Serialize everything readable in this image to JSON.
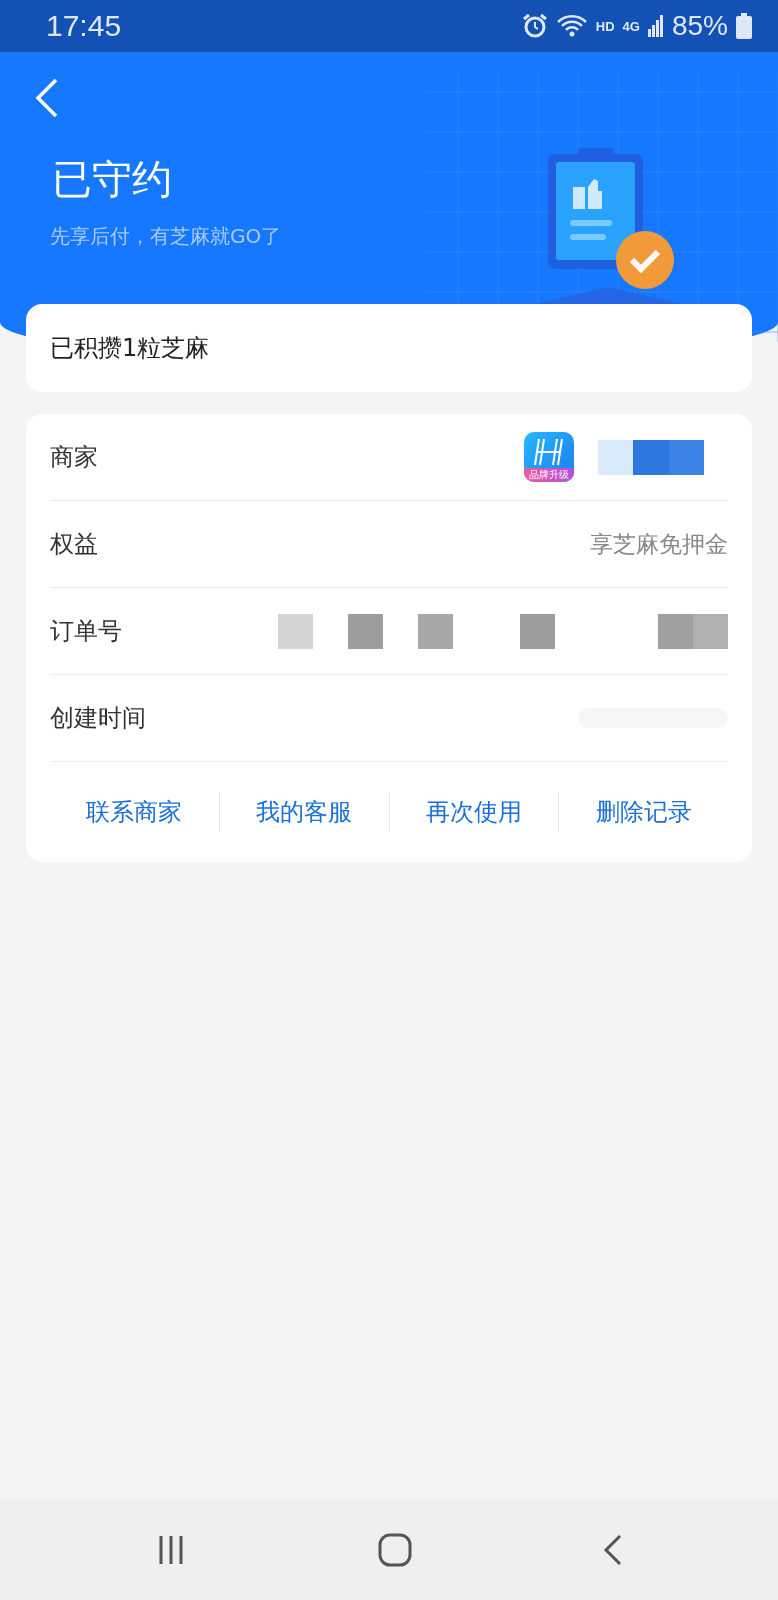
{
  "status_bar": {
    "time": "17:45",
    "network_labels": [
      "HD",
      "4G"
    ],
    "battery": "85%"
  },
  "header": {
    "title": "已守约",
    "subtitle": "先享后付，有芝麻就GO了"
  },
  "sesame": {
    "text": "已积攒1粒芝麻"
  },
  "details": [
    {
      "label": "商家",
      "kind": "merchant",
      "badge": "品牌升级"
    },
    {
      "label": "权益",
      "kind": "text",
      "value": "享芝麻免押金"
    },
    {
      "label": "订单号",
      "kind": "redacted"
    },
    {
      "label": "创建时间",
      "kind": "blurred"
    }
  ],
  "actions": [
    "联系商家",
    "我的客服",
    "再次使用",
    "删除记录"
  ]
}
